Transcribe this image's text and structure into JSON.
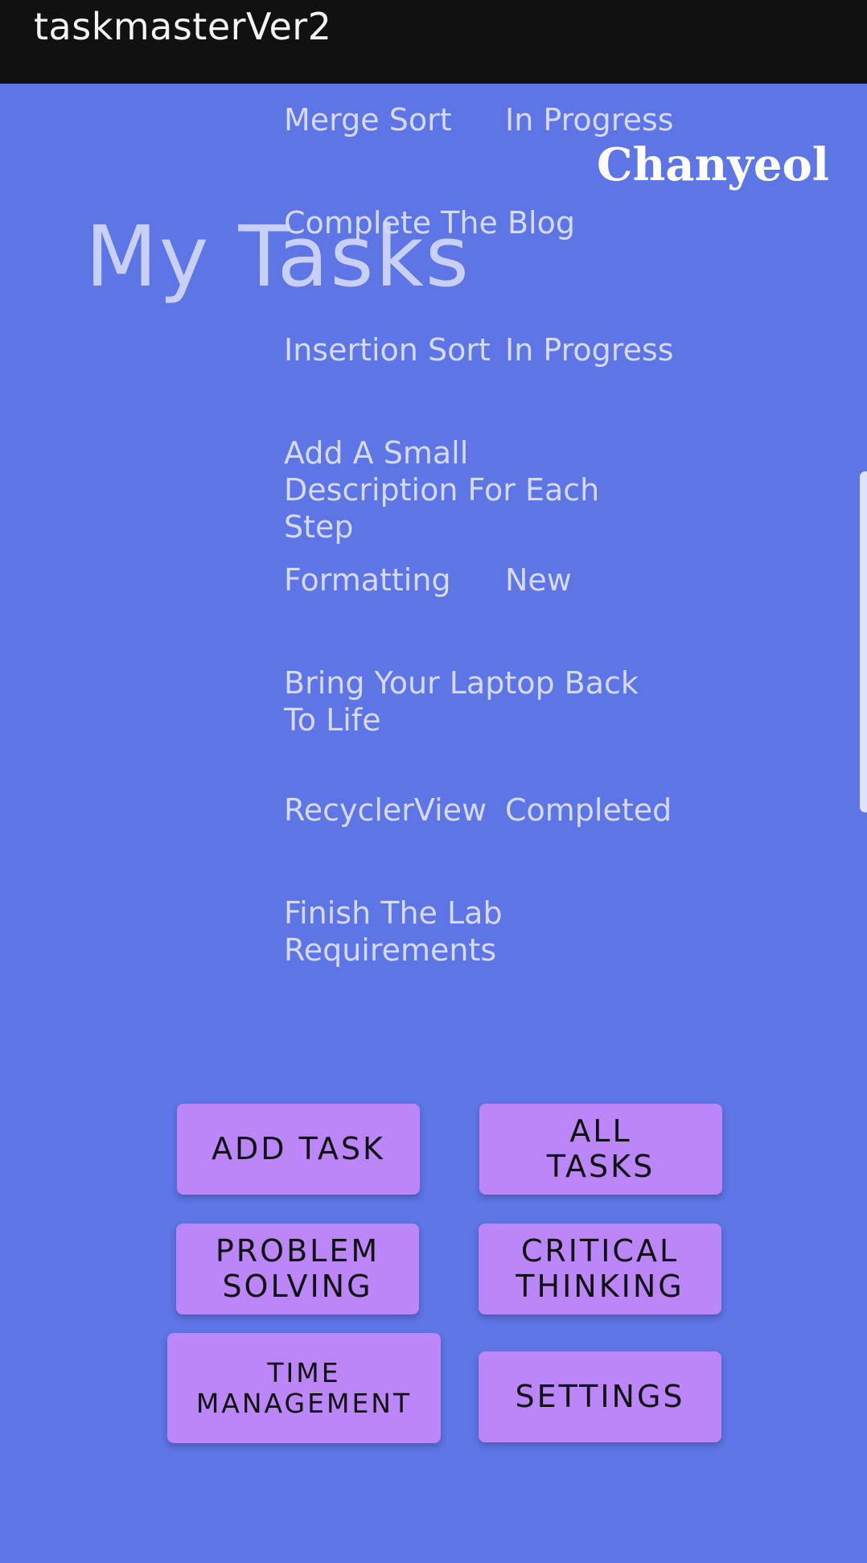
{
  "app_bar": {
    "title": "taskmasterVer2"
  },
  "header": {
    "username": "Chanyeol",
    "page_title": "My Tasks"
  },
  "tasks": [
    {
      "title": "Merge Sort",
      "status": "In Progress"
    },
    {
      "title": "Complete The Blog",
      "status": ""
    },
    {
      "title": "Insertion Sort",
      "status": "In Progress"
    },
    {
      "title": "Add A Small Description For Each Step",
      "status": ""
    },
    {
      "title": "Formatting",
      "status": "New"
    },
    {
      "title": "Bring Your Laptop Back To Life",
      "status": ""
    },
    {
      "title": "RecyclerView",
      "status": "Completed"
    },
    {
      "title": "Finish The Lab Requirements",
      "status": ""
    }
  ],
  "buttons": {
    "add_task": "ADD TASK",
    "all_tasks": "ALL\nTASKS",
    "problem_solving": "PROBLEM\nSOLVING",
    "critical_thinking": "CRITICAL\nTHINKING",
    "time_management": "TIME\nMANAGEMENT",
    "settings": "SETTINGS"
  },
  "colors": {
    "background": "#5d75e5",
    "app_bar": "#111111",
    "button": "#bb86f8"
  }
}
